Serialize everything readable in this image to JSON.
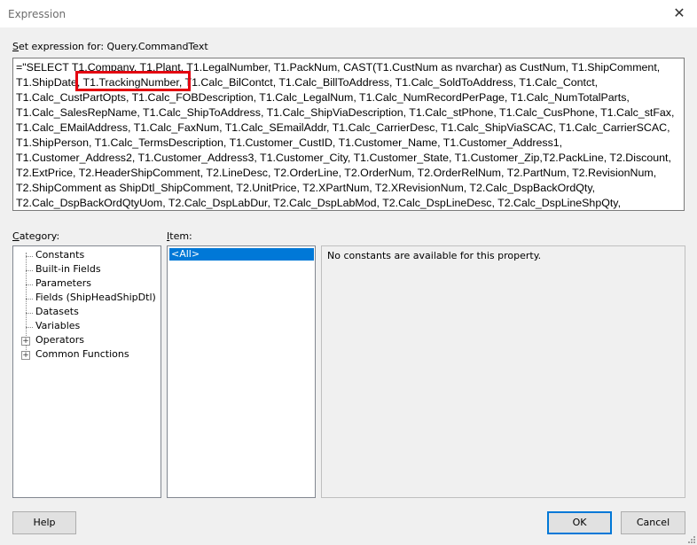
{
  "window": {
    "title": "Expression",
    "close_symbol": "✕"
  },
  "expression": {
    "label_prefix": "S",
    "label_rest": "et expression for: Query.CommandText",
    "lines": [
      "=\"SELECT T1.Company, T1.Plant, T1.LegalNumber, T1.PackNum, CAST(T1.CustNum as nvarchar) as CustNum, T1.ShipComment,",
      "T1.ShipDate, T1.TrackingNumber, T1.Calc_BilContct, T1.Calc_BillToAddress, T1.Calc_SoldToAddress, T1.Calc_Contct,",
      "T1.Calc_CustPartOpts, T1.Calc_FOBDescription, T1.Calc_LegalNum, T1.Calc_NumRecordPerPage, T1.Calc_NumTotalParts,",
      "T1.Calc_SalesRepName, T1.Calc_ShipToAddress, T1.Calc_ShipViaDescription, T1.Calc_stPhone, T1.Calc_CusPhone, T1.Calc_stFax,",
      "T1.Calc_EMailAddress, T1.Calc_FaxNum, T1.Calc_SEmailAddr, T1.Calc_CarrierDesc, T1.Calc_ShipViaSCAC, T1.Calc_CarrierSCAC,",
      "T1.ShipPerson, T1.Calc_TermsDescription, T1.Customer_CustID, T1.Customer_Name, T1.Customer_Address1,",
      "T1.Customer_Address2, T1.Customer_Address3, T1.Customer_City, T1.Customer_State, T1.Customer_Zip,T2.PackLine, T2.Discount,",
      "T2.ExtPrice, T2.HeaderShipComment, T2.LineDesc, T2.OrderLine, T2.OrderNum, T2.OrderRelNum, T2.PartNum, T2.RevisionNum,",
      "T2.ShipComment as ShipDtl_ShipComment, T2.UnitPrice, T2.XPartNum, T2.XRevisionNum, T2.Calc_DspBackOrdQty,",
      "T2.Calc_DspBackOrdQtyUom, T2.Calc_DspLabDur, T2.Calc_DspLabMod, T2.Calc_DspLineDesc, T2.Calc_DspLineShpQty,"
    ]
  },
  "category": {
    "label_prefix": "C",
    "label_rest": "ategory:",
    "items": [
      {
        "label": "Constants"
      },
      {
        "label": "Built-in Fields"
      },
      {
        "label": "Parameters"
      },
      {
        "label": "Fields (ShipHeadShipDtl)"
      },
      {
        "label": "Datasets"
      },
      {
        "label": "Variables"
      },
      {
        "label": "Operators",
        "expander": "+"
      },
      {
        "label": "Common Functions",
        "expander": "+"
      }
    ]
  },
  "item": {
    "label_prefix": "I",
    "label_rest": "tem:",
    "selected": "<All>"
  },
  "info": {
    "text": "No constants are available for this property."
  },
  "buttons": {
    "help": "Help",
    "ok": "OK",
    "cancel": "Cancel"
  },
  "colors": {
    "selection": "#0078d7",
    "highlight_box": "#e3000f"
  }
}
